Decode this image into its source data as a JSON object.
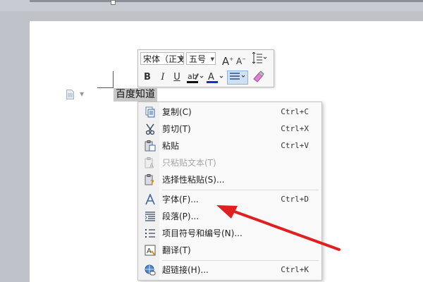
{
  "mini_toolbar": {
    "font_name": "宋体（正文）",
    "font_size": "五号",
    "grow_font": "A",
    "shrink_font": "A",
    "bold": "B",
    "italic": "I",
    "underline": "U",
    "font_color_letter": "A",
    "font_color": "#1530c7",
    "highlight_color": "#111111"
  },
  "document": {
    "selected_text": "百度知道"
  },
  "context_menu": {
    "items": [
      {
        "label": "复制(C)",
        "shortcut": "Ctrl+C"
      },
      {
        "label": "剪切(T)",
        "shortcut": "Ctrl+X"
      },
      {
        "label": "粘贴",
        "shortcut": "Ctrl+V"
      },
      {
        "label": "只粘贴文本(T)",
        "shortcut": ""
      },
      {
        "label": "选择性粘贴(S)...",
        "shortcut": ""
      },
      {
        "label": "字体(F)...",
        "shortcut": "Ctrl+D"
      },
      {
        "label": "段落(P)...",
        "shortcut": ""
      },
      {
        "label": "项目符号和编号(N)...",
        "shortcut": ""
      },
      {
        "label": "翻译(T)",
        "shortcut": ""
      },
      {
        "label": "超链接(H)...",
        "shortcut": "Ctrl+K"
      }
    ]
  },
  "annotation": {
    "arrow_color": "#e02020"
  }
}
